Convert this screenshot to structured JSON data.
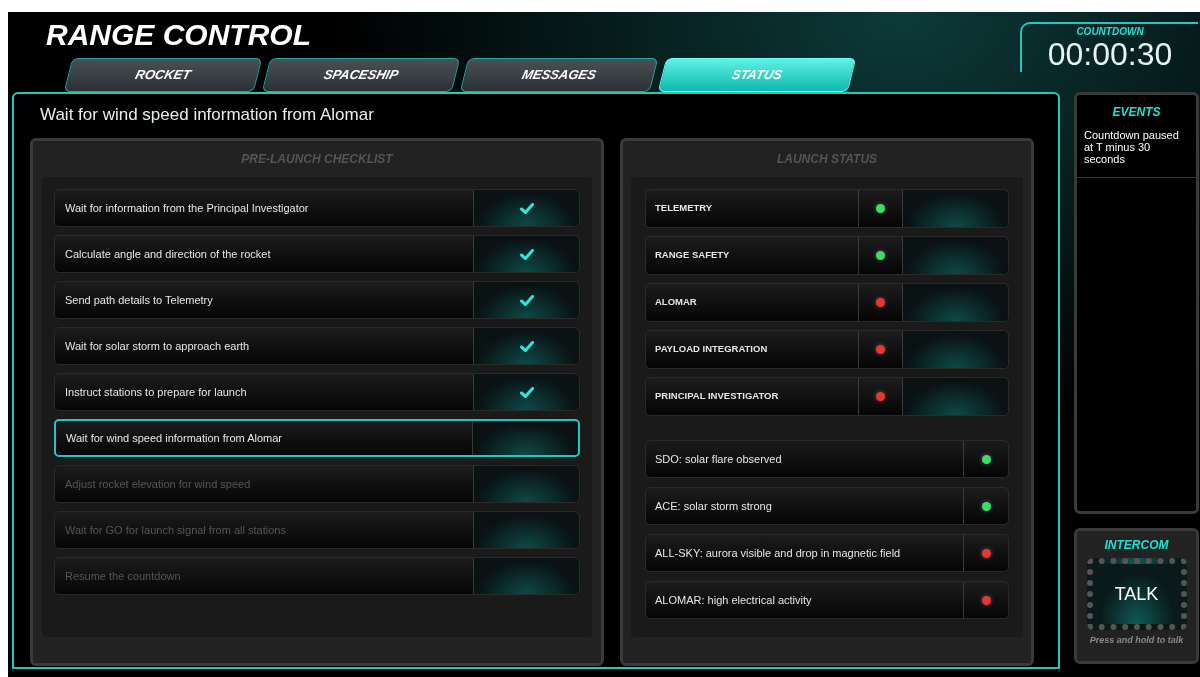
{
  "app_title": "RANGE CONTROL",
  "tabs": [
    {
      "label": "ROCKET",
      "selected": false
    },
    {
      "label": "SPACESHIP",
      "selected": false
    },
    {
      "label": "MESSAGES",
      "selected": false
    },
    {
      "label": "STATUS",
      "selected": true
    }
  ],
  "countdown": {
    "label": "COUNTDOWN",
    "time": "00:00:30"
  },
  "current_step": "Wait for wind speed information from Alomar",
  "checklist": {
    "title": "PRE-LAUNCH CHECKLIST",
    "items": [
      {
        "text": "Wait for information from the Principal Investigator",
        "checked": true,
        "selected": false,
        "disabled": false
      },
      {
        "text": "Calculate angle and direction of the rocket",
        "checked": true,
        "selected": false,
        "disabled": false
      },
      {
        "text": "Send path details to Telemetry",
        "checked": true,
        "selected": false,
        "disabled": false
      },
      {
        "text": "Wait for solar storm to approach earth",
        "checked": true,
        "selected": false,
        "disabled": false
      },
      {
        "text": "Instruct stations to prepare for launch",
        "checked": true,
        "selected": false,
        "disabled": false
      },
      {
        "text": "Wait for wind speed information from Alomar",
        "checked": false,
        "selected": true,
        "disabled": false
      },
      {
        "text": "Adjust rocket elevation for wind speed",
        "checked": false,
        "selected": false,
        "disabled": true
      },
      {
        "text": "Wait for GO for launch signal from all stations",
        "checked": false,
        "selected": false,
        "disabled": true
      },
      {
        "text": "Resume the countdown",
        "checked": false,
        "selected": false,
        "disabled": true
      }
    ]
  },
  "launch_status": {
    "title": "LAUNCH STATUS",
    "stations": [
      {
        "name": "TELEMETRY",
        "color": "#3ddc6a"
      },
      {
        "name": "RANGE SAFETY",
        "color": "#3ddc6a"
      },
      {
        "name": "ALOMAR",
        "color": "#e8362e"
      },
      {
        "name": "PAYLOAD INTEGRATION",
        "color": "#e8362e"
      },
      {
        "name": "PRINCIPAL INVESTIGATOR",
        "color": "#e8362e"
      }
    ],
    "observations": [
      {
        "text": "SDO: solar flare observed",
        "color": "#3ddc6a"
      },
      {
        "text": "ACE: solar storm strong",
        "color": "#3ddc6a"
      },
      {
        "text": "ALL-SKY: aurora visible and drop in magnetic field",
        "color": "#e8362e"
      },
      {
        "text": "ALOMAR: high electrical activity",
        "color": "#e8362e"
      }
    ]
  },
  "events": {
    "title": "EVENTS",
    "entries": [
      "Countdown paused at T minus 30 seconds"
    ]
  },
  "intercom": {
    "title": "INTERCOM",
    "button": "TALK",
    "hint": "Press and hold to talk"
  }
}
